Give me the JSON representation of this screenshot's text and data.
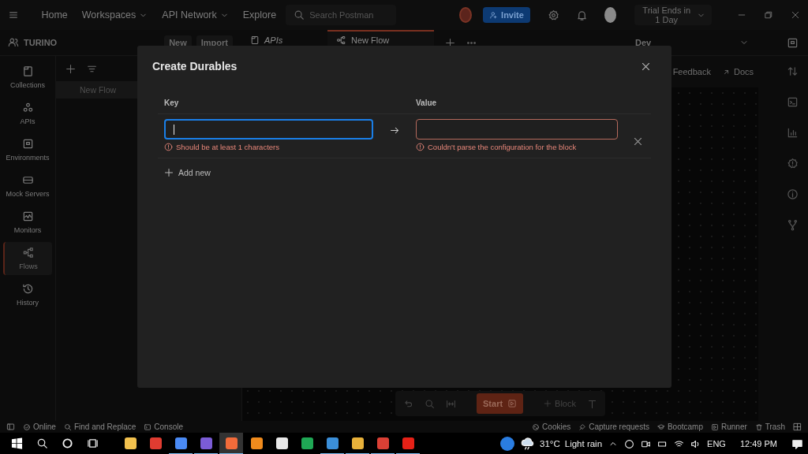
{
  "topbar": {
    "nav": [
      {
        "label": "Home",
        "dropdown": false
      },
      {
        "label": "Workspaces",
        "dropdown": true
      },
      {
        "label": "API Network",
        "dropdown": true
      },
      {
        "label": "Explore",
        "dropdown": false
      }
    ],
    "search": {
      "placeholder": "Search Postman"
    },
    "invite": "Invite",
    "trial": "Trial Ends in 1 Day"
  },
  "workspace": {
    "name": "TURINO",
    "buttons": [
      "New",
      "Import"
    ]
  },
  "tabs": [
    {
      "label": "APIs",
      "selected": false
    },
    {
      "label": "New Flow",
      "selected": true
    }
  ],
  "environment": "Dev",
  "sidebar": {
    "items": [
      {
        "label": "Collections",
        "selected": false
      },
      {
        "label": "APIs",
        "selected": false
      },
      {
        "label": "Environments",
        "selected": false
      },
      {
        "label": "Mock Servers",
        "selected": false
      },
      {
        "label": "Monitors",
        "selected": false
      },
      {
        "label": "Flows",
        "selected": true
      },
      {
        "label": "History",
        "selected": false
      }
    ]
  },
  "panel": {
    "items": [
      "New Flow"
    ]
  },
  "links": [
    "Feedback",
    "Docs"
  ],
  "canvas_toolbar": {
    "start": "Start",
    "block": "Block"
  },
  "status_bar": {
    "left": [
      "Online",
      "Find and Replace",
      "Console"
    ],
    "right": [
      "Cookies",
      "Capture requests",
      "Bootcamp",
      "Runner",
      "Trash"
    ]
  },
  "taskbar": {
    "apps": [
      {
        "open": false
      },
      {
        "open": false
      },
      {
        "open": true
      },
      {
        "open": true
      },
      {
        "open": true,
        "selected": true
      },
      {
        "open": false
      },
      {
        "open": false
      },
      {
        "open": false
      },
      {
        "open": true
      },
      {
        "open": true
      },
      {
        "open": true
      },
      {
        "open": true
      }
    ],
    "weather": {
      "temperature": "31°C",
      "condition": "Light rain"
    },
    "language": "ENG",
    "time": "12:49 PM"
  },
  "dialog": {
    "title": "Create Durables",
    "columns": [
      "Key",
      "Value"
    ],
    "rows": [
      {
        "key": {
          "focused": true,
          "error": "Should be at least 1 characters"
        },
        "value": {
          "focused": false,
          "error": "Couldn't parse the configuration for the block"
        }
      }
    ],
    "add": "Add new"
  }
}
